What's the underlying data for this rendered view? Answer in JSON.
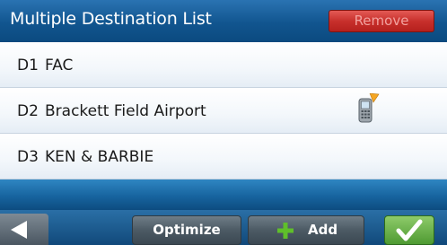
{
  "header": {
    "title": "Multiple Destination List",
    "remove_label": "Remove"
  },
  "destinations": [
    {
      "code": "D1",
      "name": "FAC",
      "icon": null
    },
    {
      "code": "D2",
      "name": "Brackett Field Airport",
      "icon": "phone-icon"
    },
    {
      "code": "D3",
      "name": "KEN & BARBIE",
      "icon": null
    }
  ],
  "toolbar": {
    "back_icon": "back-arrow-icon",
    "optimize_label": "Optimize",
    "add_icon": "plus-icon",
    "add_label": "Add",
    "ok_icon": "checkmark-icon"
  },
  "colors": {
    "title_bar": "#11558f",
    "remove_button": "#c8302c",
    "add_plus": "#5fbf2a",
    "ok_button": "#4e9a32"
  }
}
